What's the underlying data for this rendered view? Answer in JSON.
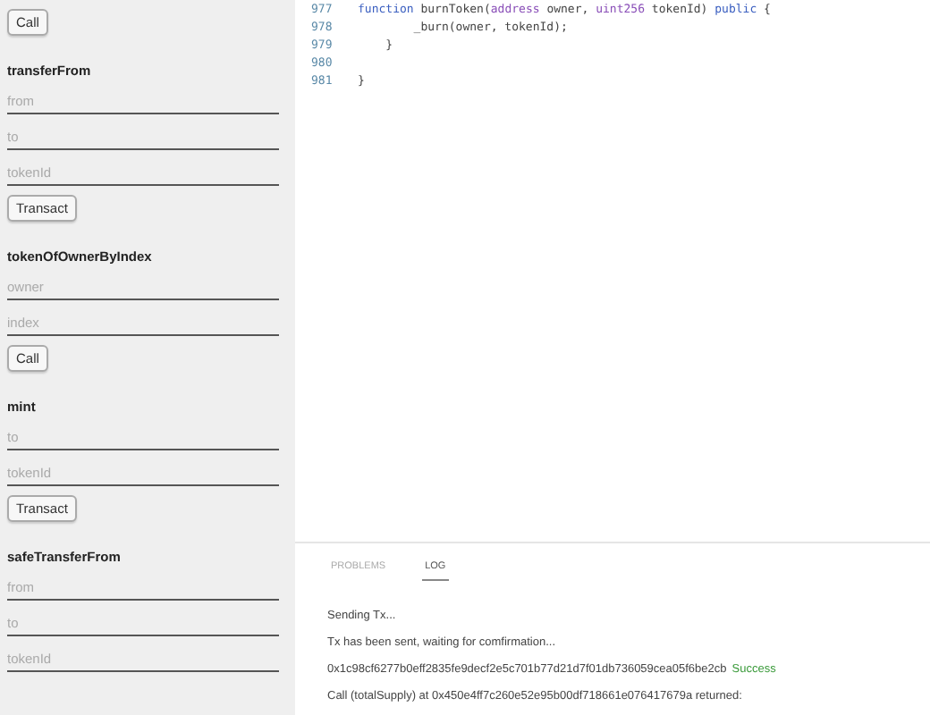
{
  "sidebar": {
    "top_button": "Call",
    "functions": [
      {
        "name": "transferFrom",
        "inputs": [
          {
            "placeholder": "from"
          },
          {
            "placeholder": "to"
          },
          {
            "placeholder": "tokenId"
          }
        ],
        "button": "Transact"
      },
      {
        "name": "tokenOfOwnerByIndex",
        "inputs": [
          {
            "placeholder": "owner"
          },
          {
            "placeholder": "index"
          }
        ],
        "button": "Call"
      },
      {
        "name": "mint",
        "inputs": [
          {
            "placeholder": "to"
          },
          {
            "placeholder": "tokenId"
          }
        ],
        "button": "Transact"
      },
      {
        "name": "safeTransferFrom",
        "inputs": [
          {
            "placeholder": "from"
          },
          {
            "placeholder": "to"
          },
          {
            "placeholder": "tokenId"
          }
        ]
      }
    ]
  },
  "editor": {
    "lines": [
      {
        "number": "977",
        "tokens": [
          {
            "text": "function ",
            "kind": "keyword"
          },
          {
            "text": "burnToken(",
            "kind": "plain"
          },
          {
            "text": "address",
            "kind": "type"
          },
          {
            "text": " owner, ",
            "kind": "plain"
          },
          {
            "text": "uint256",
            "kind": "type"
          },
          {
            "text": " tokenId) ",
            "kind": "plain"
          },
          {
            "text": "public",
            "kind": "keyword"
          },
          {
            "text": " {",
            "kind": "plain"
          }
        ]
      },
      {
        "number": "978",
        "tokens": [
          {
            "text": "        _burn(owner, tokenId);",
            "kind": "plain"
          }
        ]
      },
      {
        "number": "979",
        "tokens": [
          {
            "text": "    }",
            "kind": "plain"
          }
        ]
      },
      {
        "number": "980"
      },
      {
        "number": "981",
        "tokens": [
          {
            "text": "}",
            "kind": "plain"
          }
        ]
      }
    ]
  },
  "panel": {
    "tabs": [
      {
        "label": "PROBLEMS",
        "selected": false
      },
      {
        "label": "LOG",
        "selected": true
      }
    ],
    "log": [
      {
        "text": "Sending Tx..."
      },
      {
        "text": "Tx has been sent, waiting for comfirmation..."
      },
      {
        "text": "0x1c98cf6277b0eff2835fe9decf2e5c701b77d21d7f01db736059cea05f6be2cb",
        "status": "Success"
      },
      {
        "text": "Call (totalSupply) at 0x450e4ff7c260e52e95b00df718661e076417679a returned:"
      }
    ]
  }
}
